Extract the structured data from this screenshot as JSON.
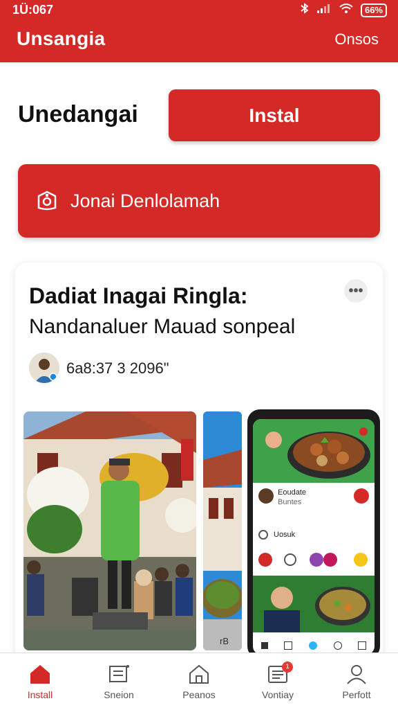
{
  "status": {
    "time": "1Ü:067",
    "battery": "66%"
  },
  "appbar": {
    "title": "Unsangia",
    "action": "Onsos"
  },
  "hero": {
    "headline": "Unedangai",
    "install_label": "Instal",
    "promo_label": "Jonai Denlolamah"
  },
  "post": {
    "title": "Dadiat Inagai Ringla:",
    "subtitle": "Nandanaluer Mauad sonpeal",
    "meta": "6a8:37 3 2096\"",
    "phone": {
      "row1_name": "Eoudate",
      "row1_sub": "Buntes",
      "row2_label": "Uosuk",
      "tag": "rB"
    }
  },
  "nav": {
    "items": [
      "Install",
      "Sneion",
      "Peanos",
      "Vontiay",
      "Perfott"
    ],
    "badge": "1"
  },
  "colors": {
    "brand": "#d42a27",
    "nav_active": "#d42a27"
  }
}
